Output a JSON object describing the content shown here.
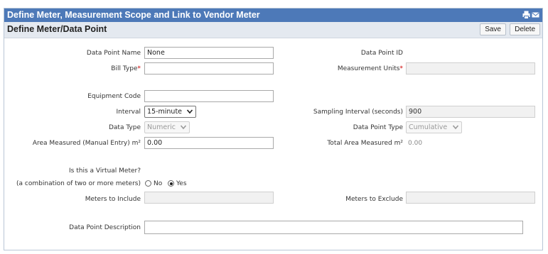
{
  "window": {
    "title": "Define Meter, Measurement Scope and Link to Vendor Meter"
  },
  "toolbar": {
    "section_title": "Define Meter/Data Point",
    "save_label": "Save",
    "delete_label": "Delete"
  },
  "icons": {
    "print": "printer-icon",
    "email": "envelope-icon"
  },
  "form": {
    "data_point_name_label": "Data Point Name",
    "data_point_name_value": "None",
    "data_point_id_label": "Data Point ID",
    "bill_type_label": "Bill Type",
    "measurement_units_label": "Measurement Units",
    "required_mark": "*",
    "equipment_code_label": "Equipment Code",
    "interval_label": "Interval",
    "interval_value": "15-minute",
    "sampling_interval_label": "Sampling Interval (seconds)",
    "sampling_interval_value": "900",
    "data_type_label": "Data Type",
    "data_type_value": "Numeric",
    "data_point_type_label": "Data Point Type",
    "data_point_type_value": "Cumulative",
    "area_measured_label": "Area Measured (Manual Entry) m²",
    "area_measured_value": "0.00",
    "total_area_label": "Total Area Measured m²",
    "total_area_value": "0.00",
    "virtual_meter_label": "Is this a Virtual Meter?",
    "virtual_meter_sub_label": "(a combination of two or more meters)",
    "radio_no_label": "No",
    "radio_yes_label": "Yes",
    "virtual_meter_selected": "Yes",
    "meters_include_label": "Meters to Include",
    "meters_exclude_label": "Meters to Exclude",
    "description_label": "Data Point Description"
  },
  "colors": {
    "title_bar": "#4d79b8",
    "sub_bar": "#e4e9f0",
    "required": "#cc0000"
  }
}
